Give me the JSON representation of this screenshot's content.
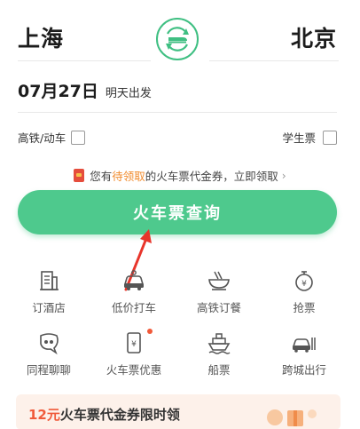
{
  "stations": {
    "from": "上海",
    "to": "北京"
  },
  "date": {
    "value": "07月27日",
    "subtitle": "明天出发"
  },
  "options": {
    "highspeed_label": "高铁/动车",
    "student_label": "学生票"
  },
  "promo": {
    "prefix": "您有",
    "highlight": "待领取",
    "suffix": "的火车票代金券，立即领取",
    "chevron": "›"
  },
  "query_button": {
    "label": "火车票查询"
  },
  "services": [
    {
      "label": "订酒店",
      "icon": "hotel-icon"
    },
    {
      "label": "低价打车",
      "icon": "car-icon"
    },
    {
      "label": "高铁订餐",
      "icon": "meal-icon"
    },
    {
      "label": "抢票",
      "icon": "stopwatch-icon"
    },
    {
      "label": "同程聊聊",
      "icon": "chat-icon"
    },
    {
      "label": "火车票优惠",
      "icon": "coupon-icon"
    },
    {
      "label": "船票",
      "icon": "ship-icon"
    },
    {
      "label": "跨城出行",
      "icon": "intercity-car-icon"
    }
  ],
  "banner": {
    "amount": "12元",
    "text": "火车票代金券限时领"
  },
  "colors": {
    "brand_green": "#4ec98d",
    "highlight_orange": "#f18b2c",
    "arrow_red": "#e8352b"
  }
}
